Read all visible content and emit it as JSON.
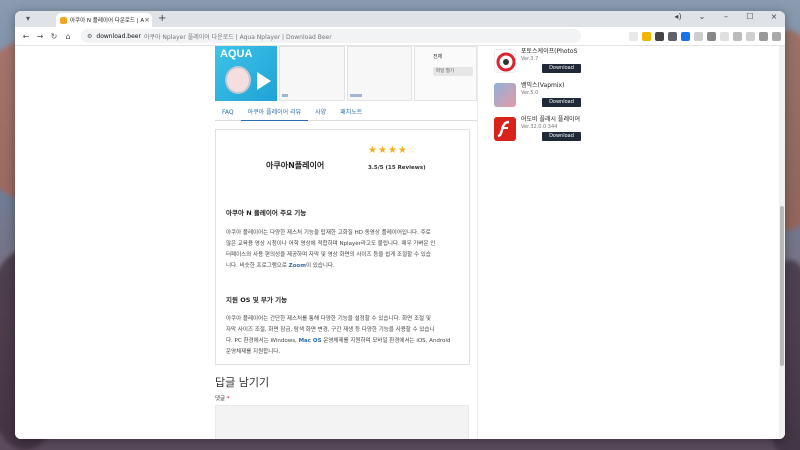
{
  "browser": {
    "tab_title": "아쿠아 N 플레이어 다운로드 | A",
    "url_domain": "download.beer",
    "url_path": "아쿠아 Nplayer 플레이어 다운로드 | Aqua Nplayer | Download Beer"
  },
  "banner": {
    "logo_text": "AQUA",
    "screenshot_label": "전체",
    "screenshot_btn": "파일 열기"
  },
  "tabs": [
    {
      "label": "FAQ"
    },
    {
      "label": "아쿠아 플레이어 리뷰"
    },
    {
      "label": "사양"
    },
    {
      "label": "패치노트"
    }
  ],
  "review": {
    "app_title": "아쿠아N플레이어",
    "rating_value": 3.5,
    "rating_text": "3.5/5 (15 Reviews)",
    "section1_title": "아쿠아 N 플레이어 주요 기능",
    "section1_p1": "아쿠아 플레이어는 다양한 제스처 기능을 탑재한 고화질 HD 동영상 플레이어입니다. 주로",
    "section1_p2": "많은 교육용 영상 시청이나 어학 영상에 적합하며 Nplayer라고도 불립니다. 매우 가벼운 인",
    "section1_p3": "터페이스와 사용 편의성을 제공하며 자막 및 영상 화면의 사이즈 등을 쉽게 조절할 수 있습",
    "section1_p4a": "니다. 비슷한 프로그램으로 ",
    "section1_link": "Zoom",
    "section1_p4b": "이 있습니다.",
    "section2_title": "지원 OS 및 부가 기능",
    "section2_p1": "아쿠아 플레이어는 간단한 제스처를 통해 다양한 기능을 설정할 수 있습니다. 화면 조절 및",
    "section2_p2": "자막 사이즈 조절, 화면 잠금, 탐색 화면 변경, 구간 재생 등 다양한 기능을 사용할 수 있습니",
    "section2_p3a": "다. PC 환경에서는 Windows, ",
    "section2_link": "Mac OS",
    "section2_p3b": " 운영체제를 지원하며 모바일 환경에서는 iOS, Android",
    "section2_p4": "운영체제를 지원합니다."
  },
  "reply": {
    "title": "답글 남기기",
    "label": "댓글",
    "required_mark": "*"
  },
  "sidebar": {
    "items": [
      {
        "name": "포토스케이프(PhotoS",
        "version": "Ver.3.7",
        "button": "Download",
        "color": "#ffffff"
      },
      {
        "name": "뱀믹스(Vapmix)",
        "version": "Ver.5.0",
        "button": "Download",
        "color": "#c9d6e8"
      },
      {
        "name": "어도비 플래시 플레이어",
        "version": "Ver.32.0.0.344",
        "button": "Download",
        "color": "#d9221c"
      }
    ]
  }
}
